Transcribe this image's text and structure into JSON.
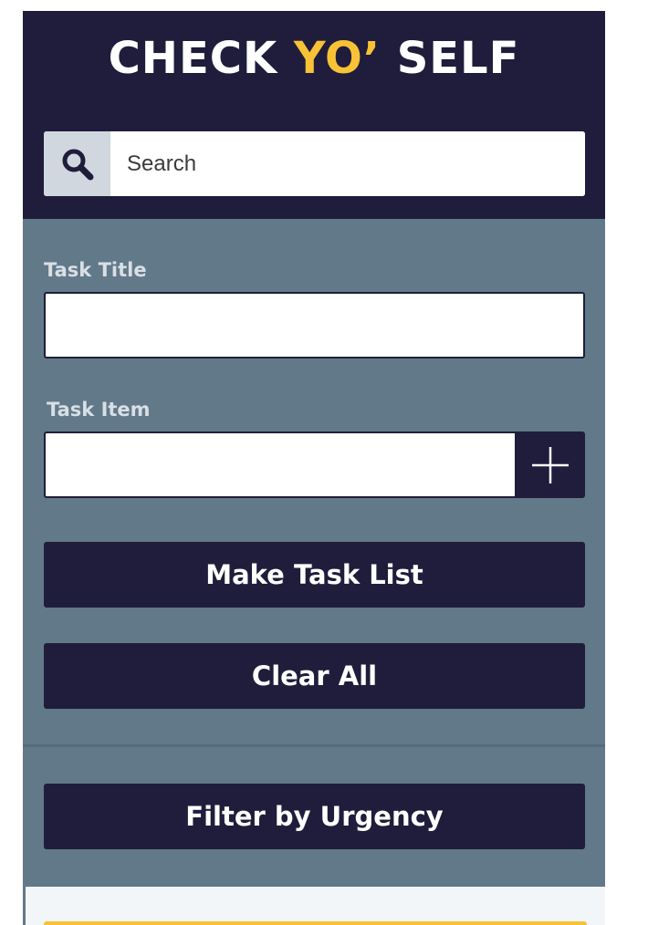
{
  "header": {
    "title_part1": "CHECK ",
    "title_accent": "YO’",
    "title_part2": " SELF"
  },
  "search": {
    "placeholder": "Search",
    "icon": "search-icon"
  },
  "form": {
    "task_title_label": "Task Title",
    "task_title_value": "",
    "task_item_label": "Task Item",
    "task_item_value": "",
    "add_icon": "plus-icon"
  },
  "actions": {
    "make_task_list": "Make Task List",
    "clear_all": "Clear All",
    "filter_by_urgency": "Filter by Urgency"
  },
  "colors": {
    "navy": "#1f1d3b",
    "slate": "#62798a",
    "accent_yellow": "#f7c236",
    "white": "#ffffff"
  }
}
